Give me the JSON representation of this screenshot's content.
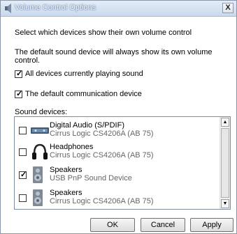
{
  "window": {
    "title": "Volume Control Options",
    "close_label": "X"
  },
  "intro": "Select which devices show their own volume control",
  "note": "The default sound device will always show its own volume control.",
  "options": [
    {
      "label": "All devices currently playing sound",
      "checked": true
    },
    {
      "label": "The default communication device",
      "checked": true
    }
  ],
  "devices_label": "Sound devices:",
  "devices": [
    {
      "name": "Digital Audio (S/PDIF)",
      "sub": "Cirrus Logic CS4206A (AB 75)",
      "checked": false,
      "icon": "digital-audio-icon"
    },
    {
      "name": "Headphones",
      "sub": "Cirrus Logic CS4206A (AB 75)",
      "checked": false,
      "icon": "headphones-icon"
    },
    {
      "name": "Speakers",
      "sub": "USB PnP Sound Device",
      "checked": true,
      "icon": "speakers-icon"
    },
    {
      "name": "Speakers",
      "sub": "Cirrus Logic CS4206A (AB 75)",
      "checked": false,
      "icon": "speakers-icon"
    }
  ],
  "buttons": {
    "ok": "OK",
    "cancel": "Cancel",
    "apply": "Apply"
  },
  "checkmark": "✓",
  "scroll": {
    "up": "▲",
    "down": "▼"
  }
}
